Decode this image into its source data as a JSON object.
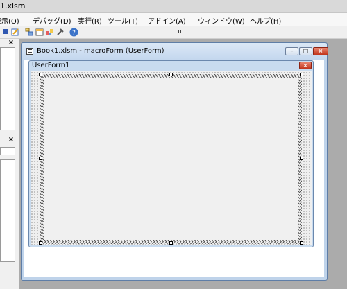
{
  "app": {
    "title_fragment": "1.xlsm"
  },
  "menubar": {
    "items": [
      {
        "label": "表示(O)"
      },
      {
        "label": "デバッグ(D)"
      },
      {
        "label": "実行(R)"
      },
      {
        "label": "ツール(T)"
      },
      {
        "label": "アドイン(A)"
      },
      {
        "label": "ウィンドウ(W)"
      },
      {
        "label": "ヘルプ(H)"
      }
    ]
  },
  "toolbar": {
    "icons": [
      "stop-icon",
      "design-mode-icon",
      "project-explorer-icon",
      "properties-window-icon",
      "object-browser-icon",
      "toolbox-icon",
      "help-icon"
    ]
  },
  "left_pane": {
    "close_label": "×"
  },
  "code_window": {
    "title": "Book1.xlsm - macroForm (UserForm)",
    "min_glyph": "–",
    "max_glyph": "□",
    "close_glyph": "×"
  },
  "userform": {
    "caption": "UserForm1",
    "close_glyph": "×"
  },
  "colors": {
    "mdi_background": "#ababab",
    "window_frame": "#bfd3ea",
    "form_background": "#f0f0f0",
    "close_button": "#c1341b"
  }
}
